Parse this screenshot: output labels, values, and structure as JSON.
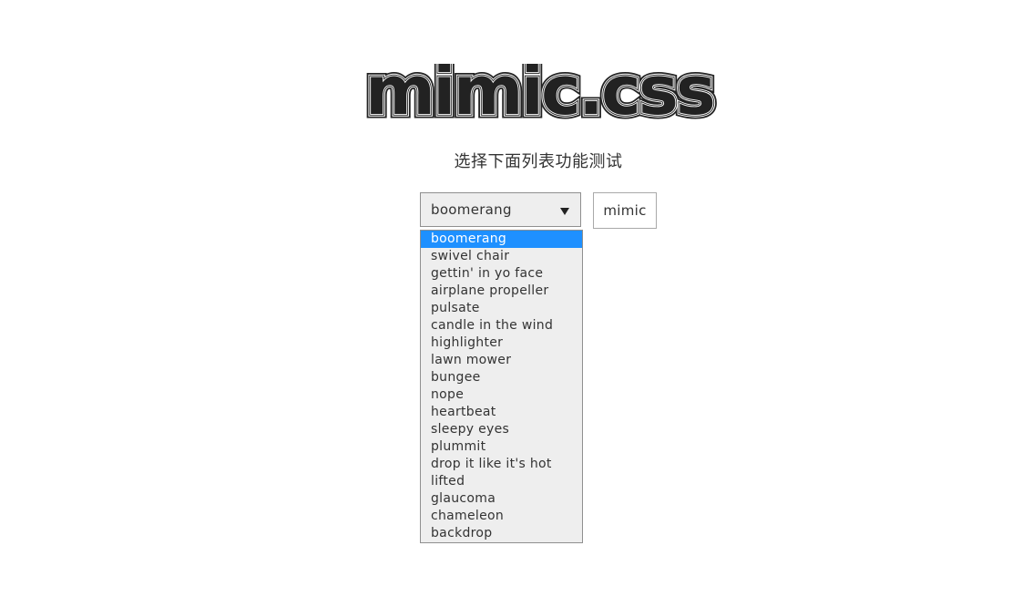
{
  "logo": {
    "text": "mimic.css",
    "color": "#222222"
  },
  "subtitle": "选择下面列表功能测试",
  "select": {
    "value": "boomerang",
    "options": [
      "boomerang",
      "swivel chair",
      "gettin' in yo face",
      "airplane propeller",
      "pulsate",
      "candle in the wind",
      "highlighter",
      "lawn mower",
      "bungee",
      "nope",
      "heartbeat",
      "sleepy eyes",
      "plummit",
      "drop it like it's hot",
      "lifted",
      "glaucoma",
      "chameleon",
      "backdrop"
    ],
    "highlight_color": "#1e90ff"
  },
  "button": {
    "label": "mimic"
  },
  "icons": {
    "caret": "caret-down-icon"
  }
}
